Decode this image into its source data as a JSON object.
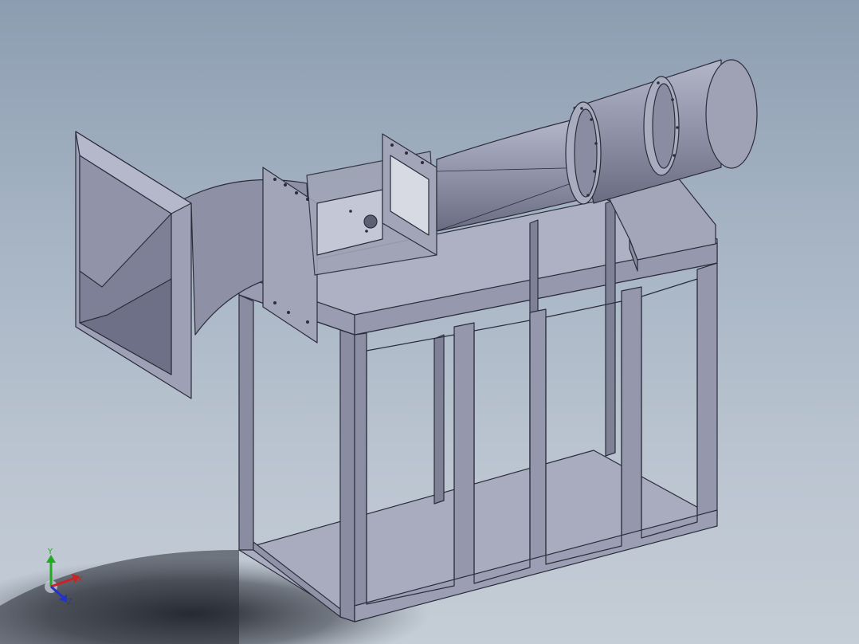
{
  "viewport": {
    "background_top": "#8d9db1",
    "background_bottom": "#c5cdd6",
    "model_color": "#8f93a8",
    "edge_color": "#2b2d3a"
  },
  "triad": {
    "x_label": "X",
    "y_label": "Y",
    "z_label": "Z",
    "x_color": "#cc2222",
    "y_color": "#22aa22",
    "z_color": "#2233cc"
  }
}
